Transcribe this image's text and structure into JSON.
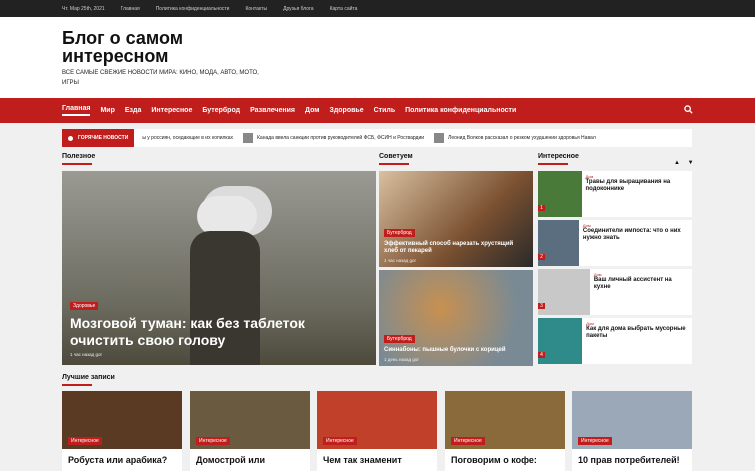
{
  "topbar": {
    "date": "Чт. Мар 25th, 2021",
    "links": [
      "Главная",
      "Политика конфиденциальности",
      "Контакты",
      "Друзья блога",
      "Карта сайта"
    ]
  },
  "site": {
    "title": "Блог о самом интересном",
    "description": "ВСЕ САМЫЕ СВЕЖИЕ НОВОСТИ МИРА: КИНО, МОДА, АВТО, МОТО, ИГРЫ"
  },
  "nav": [
    "Главная",
    "Мир",
    "Езда",
    "Интересное",
    "Бутерброд",
    "Развлечения",
    "Дом",
    "Здоровье",
    "Стиль",
    "Политика конфиденциальности"
  ],
  "ticker": {
    "label": "ГОРЯЧИЕ НОВОСТИ",
    "items": [
      "ы у россиян, оседающие в их копилках",
      "Канада ввела санкции против руководителей ФСБ, ФСИН и Росгвардии",
      "Леонид Волков рассказал о резком ухудшении здоровья Навал"
    ]
  },
  "sections": {
    "popular": "Полезное",
    "advice": "Советуем",
    "interesting": "Интересное",
    "best": "Лучшие записи"
  },
  "featured": {
    "tag": "Здоровье",
    "title": "Мозговой туман: как без таблеток очистить свою голову",
    "meta": "1 час назад   gor"
  },
  "advice": [
    {
      "tag": "Бутерброд",
      "title": "Эффективный способ нарезать хрустящий хлеб от пекарей",
      "meta": "1 час назад   gor"
    },
    {
      "tag": "Бутерброд",
      "title": "Синнабоны: пышные булочки с корицей",
      "meta": "1 день назад   gor"
    }
  ],
  "interesting": [
    {
      "num": "1",
      "cat": "Дом",
      "title": "Травы для выращивания на подоконнике",
      "color": "#4a7a3a"
    },
    {
      "num": "2",
      "cat": "Дом",
      "title": "Соединители импоста: что о них нужно знать",
      "color": "#5a6e80"
    },
    {
      "num": "3",
      "cat": "Дом",
      "title": "Ваш личный ассистент на кухне",
      "color": "#c8c8c8"
    },
    {
      "num": "4",
      "cat": "Дом",
      "title": "Как для дома выбрать мусорные пакеты",
      "color": "#2f8a8a"
    }
  ],
  "best": [
    {
      "tag": "Интересное",
      "title": "Робуста или арабика?",
      "color": "#5a3a22"
    },
    {
      "tag": "Интересное",
      "title": "Домострой или",
      "color": "#6a5a40"
    },
    {
      "tag": "Интересное",
      "title": "Чем так знаменит",
      "color": "#c0402a"
    },
    {
      "tag": "Интересное",
      "title": "Поговорим о кофе:",
      "color": "#8a6a3a"
    },
    {
      "tag": "Интересное",
      "title": "10 прав потребителей!",
      "color": "#9aa8b8"
    }
  ]
}
